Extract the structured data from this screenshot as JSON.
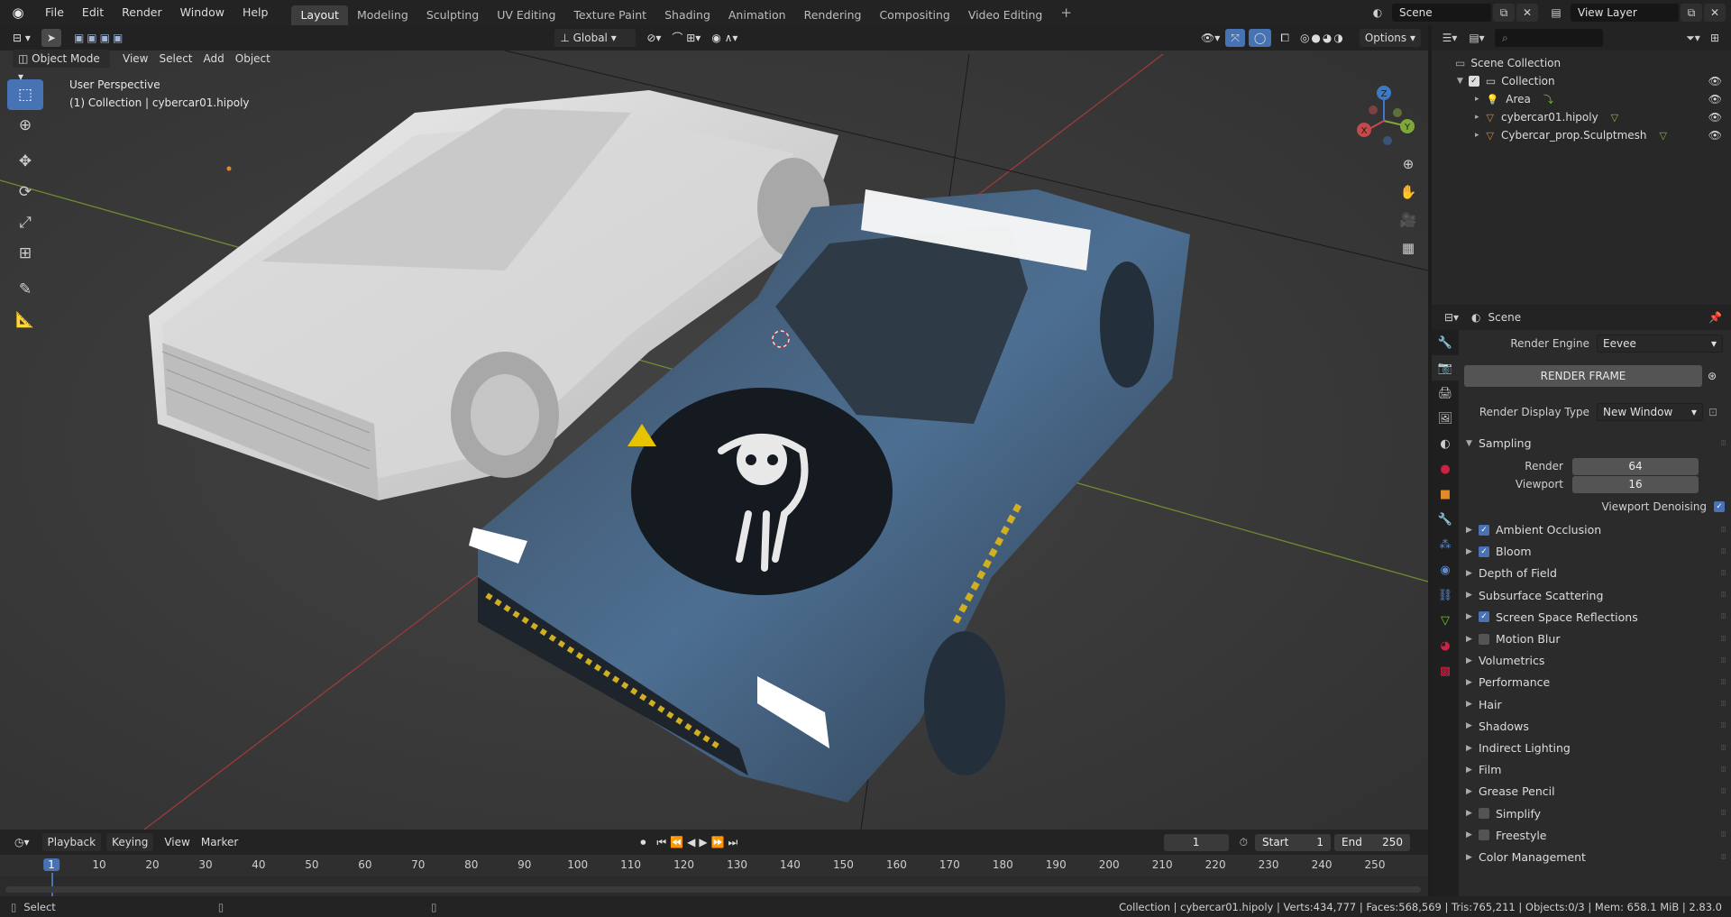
{
  "topbar": {
    "logo": "blender-logo-icon",
    "menus": [
      "File",
      "Edit",
      "Render",
      "Window",
      "Help"
    ],
    "workspaces": [
      "Layout",
      "Modeling",
      "Sculpting",
      "UV Editing",
      "Texture Paint",
      "Shading",
      "Animation",
      "Rendering",
      "Compositing",
      "Video Editing"
    ],
    "active_workspace": "Layout",
    "add_tab": "+",
    "scene": "Scene",
    "view_layer": "View Layer"
  },
  "viewport_header": {
    "mode": "Object Mode",
    "menus": [
      "View",
      "Select",
      "Add",
      "Object"
    ],
    "transform_orientation": "Global",
    "options": "Options"
  },
  "viewport": {
    "perspective": "User Perspective",
    "collection_info": "(1) Collection | cybercar01.hipoly",
    "gizmo": {
      "x": "X",
      "y": "Y",
      "z": "Z"
    }
  },
  "outliner": {
    "search_placeholder": "",
    "root": "Scene Collection",
    "collection": "Collection",
    "items": [
      {
        "name": "Area",
        "icon": "light-icon"
      },
      {
        "name": "cybercar01.hipoly",
        "icon": "mesh-icon"
      },
      {
        "name": "Cybercar_prop.Sculptmesh",
        "icon": "mesh-icon"
      }
    ]
  },
  "properties": {
    "context": "Scene",
    "render_engine_label": "Render Engine",
    "render_engine": "Eevee",
    "render_frame": "RENDER FRAME",
    "display_type_label": "Render Display Type",
    "display_type": "New Window",
    "sampling": {
      "title": "Sampling",
      "render_label": "Render",
      "render": "64",
      "viewport_label": "Viewport",
      "viewport": "16",
      "denoise": "Viewport Denoising"
    },
    "panels": [
      {
        "label": "Ambient Occlusion",
        "checkbox": true,
        "checked": true
      },
      {
        "label": "Bloom",
        "checkbox": true,
        "checked": true
      },
      {
        "label": "Depth of Field",
        "checkbox": false
      },
      {
        "label": "Subsurface Scattering",
        "checkbox": false
      },
      {
        "label": "Screen Space Reflections",
        "checkbox": true,
        "checked": true
      },
      {
        "label": "Motion Blur",
        "checkbox": true,
        "checked": false
      },
      {
        "label": "Volumetrics",
        "checkbox": false
      },
      {
        "label": "Performance",
        "checkbox": false
      },
      {
        "label": "Hair",
        "checkbox": false
      },
      {
        "label": "Shadows",
        "checkbox": false
      },
      {
        "label": "Indirect Lighting",
        "checkbox": false
      },
      {
        "label": "Film",
        "checkbox": false
      },
      {
        "label": "Grease Pencil",
        "checkbox": false
      },
      {
        "label": "Simplify",
        "checkbox": true,
        "checked": false
      },
      {
        "label": "Freestyle",
        "checkbox": true,
        "checked": false
      },
      {
        "label": "Color Management",
        "checkbox": false
      }
    ]
  },
  "timeline": {
    "menus": [
      "Playback",
      "Keying",
      "View",
      "Marker"
    ],
    "current_frame": "1",
    "start_label": "Start",
    "start": "1",
    "end_label": "End",
    "end": "250",
    "ticks": [
      "1",
      "10",
      "20",
      "30",
      "40",
      "50",
      "60",
      "70",
      "80",
      "90",
      "100",
      "110",
      "120",
      "130",
      "140",
      "150",
      "160",
      "170",
      "180",
      "190",
      "200",
      "210",
      "220",
      "230",
      "240",
      "250"
    ]
  },
  "statusbar": {
    "left": "Select",
    "stats": "Collection | cybercar01.hipoly | Verts:434,777 | Faces:568,569 | Tris:765,211 | Objects:0/3 | Mem: 658.1 MiB | 2.83.0"
  },
  "colors": {
    "accent": "#4772b3",
    "panel": "#2b2b2b",
    "header": "#232323",
    "viewport": "#393939"
  }
}
